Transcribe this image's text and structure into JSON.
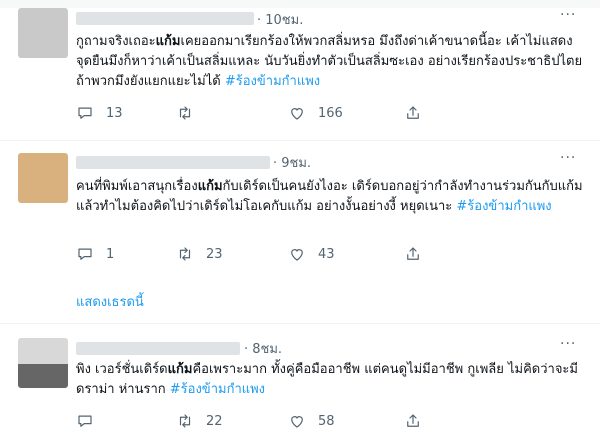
{
  "tweets": [
    {
      "time": "· 10ชม.",
      "segments": [
        {
          "t": "กูถามจริงเถอะ",
          "s": "n"
        },
        {
          "t": "แก้ม",
          "s": "b"
        },
        {
          "t": "เคยออกมาเรียกร้องให้พวกสลิ่มหรอ มึงถึงด่าเค้าขนาดนี้อะ เค้าไม่แสดงจุดยืนมึงก็หาว่าเค้าเป็นสลิ่มแหละ นับวันยิ่งทำตัวเป็นสลิ่มซะเอง อย่างเรียกร้องประชาธิปไตยถ้าพวกมึงยังแยกแยะไม่ได้ ",
          "s": "n"
        },
        {
          "t": "#ร้องข้ามกำแพง",
          "s": "tag"
        }
      ],
      "replies": "13",
      "retweets": "",
      "likes": "166"
    },
    {
      "time": "· 9ชม.",
      "segments": [
        {
          "t": "คนที่พิมพ์เอาสนุกเรื่อง",
          "s": "n"
        },
        {
          "t": "แก้ม",
          "s": "b"
        },
        {
          "t": "กับเดิร์ดเป็นคนยังไงอะ เดิร์ดบอกอยู่ว่ากำลังทำงานร่วมกันกับแก้ม แล้วทำไมต้องคิดไปว่าเดิร์ดไม่โอเคกับแก้ม อย่างงั้นอย่างงี้ หยุดเนาะ ",
          "s": "n"
        },
        {
          "t": "#ร้องข้ามกำแพง",
          "s": "tag"
        }
      ],
      "replies": "1",
      "retweets": "23",
      "likes": "43"
    },
    {
      "time": "· 8ชม.",
      "segments": [
        {
          "t": "พิง เวอร์ชั่นเดิร์ด",
          "s": "n"
        },
        {
          "t": "แก้ม",
          "s": "b"
        },
        {
          "t": "คือเพราะมาก ทั้งคู่คือมืออาชีพ แต่คนดูไม่มีอาชีพ กูเพลีย ไม่คิดว่าจะมีดราม่า ห่านราก ",
          "s": "n"
        },
        {
          "t": "#ร้องข้ามกำแพง",
          "s": "tag"
        }
      ],
      "replies": "",
      "retweets": "22",
      "likes": "58"
    }
  ],
  "show_thread": "แสดงเธรดนี้",
  "more_label": "···",
  "colors": {
    "accent": "#1d9bf0",
    "muted": "#536471",
    "avatar1": "#c9c9c9",
    "avatar2": "#d9b17f",
    "avatar3_top": "#d8d8d8",
    "avatar3_bottom": "#666666"
  },
  "icons": [
    "reply-icon",
    "retweet-icon",
    "like-icon",
    "share-icon",
    "more-icon"
  ]
}
